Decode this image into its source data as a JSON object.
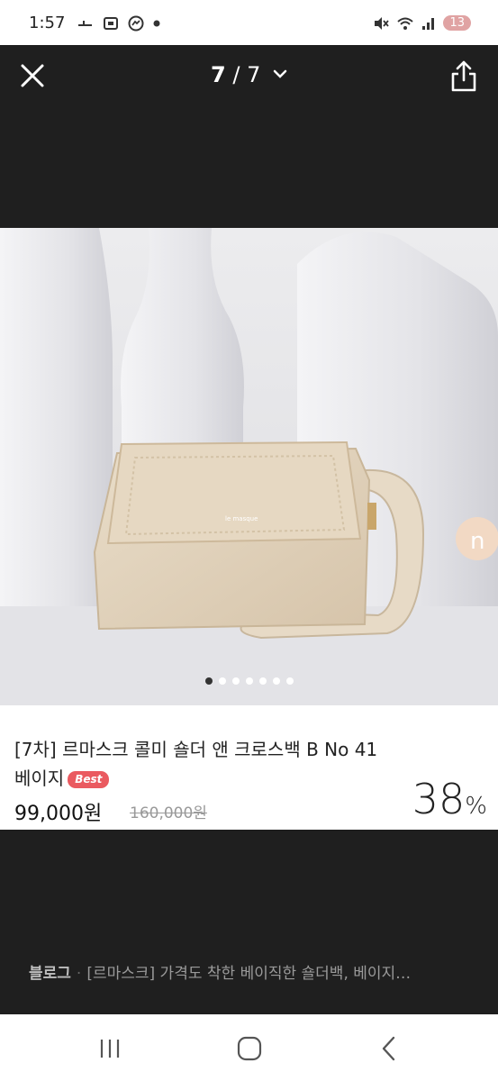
{
  "status_bar": {
    "time": "1:57",
    "battery": "13",
    "left_icons": [
      "dash-icon",
      "screenshot-icon",
      "messenger-icon",
      "dot-icon"
    ],
    "right_icons": [
      "mute-icon",
      "wifi-icon",
      "signal-icon"
    ]
  },
  "header": {
    "current": "7",
    "separator": " / ",
    "total": "7"
  },
  "carousel": {
    "dot_count": 7,
    "active_index": 0
  },
  "product": {
    "title": "[7차] 르마스크 콜미 숄더 앤 크로스백 B No 41 베이지",
    "badge": "Best",
    "price": "99,000원",
    "original_price": "160,000원",
    "discount_value": "38",
    "discount_symbol": "%"
  },
  "blog": {
    "source": "블로그",
    "separator": "·",
    "text": "[르마스크] 가격도 착한 베이직한 숄더백, 베이지…"
  },
  "colors": {
    "background": "#1f1f1f",
    "badge": "#ea5a60",
    "battery": "#e0a3a3"
  }
}
